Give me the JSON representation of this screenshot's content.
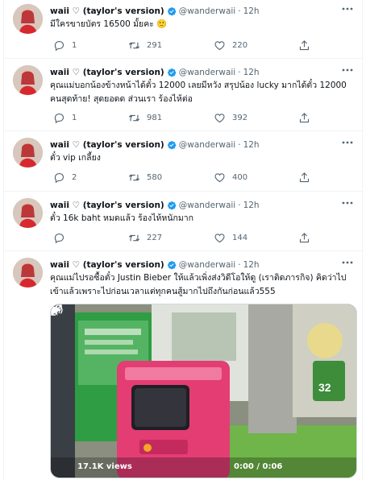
{
  "colors": {
    "accent": "#1d9bf0",
    "muted": "#536471",
    "text": "#0f1419",
    "border": "#eff3f4"
  },
  "tweets": [
    {
      "name": "waii ♡ (taylor's version)",
      "handle": "@wanderwaii",
      "dot": "·",
      "time": "12h",
      "text": "มีใครขายบัตร 16500 มั้ยคะ 🙂",
      "replies": "1",
      "retweets": "291",
      "likes": "220"
    },
    {
      "name": "waii ♡ (taylor's version)",
      "handle": "@wanderwaii",
      "dot": "·",
      "time": "12h",
      "text": "คุณแม่บอกน้องข้างหน้าได้ตั๋ว 12000 เลยมีหวัง สรุปน้อง lucky มากได้ตั๋ว 12000 คนสุดท้าย! สุดยอดด ส่วนเรา ร้องไห้ต่อ",
      "replies": "1",
      "retweets": "981",
      "likes": "392"
    },
    {
      "name": "waii ♡ (taylor's version)",
      "handle": "@wanderwaii",
      "dot": "·",
      "time": "12h",
      "text": "ตั๋ว vip เกลี้ยง",
      "replies": "2",
      "retweets": "580",
      "likes": "400"
    },
    {
      "name": "waii ♡ (taylor's version)",
      "handle": "@wanderwaii",
      "dot": "·",
      "time": "12h",
      "text": "ตั๋ว 16k baht หมดแล้ว ร้องไห้หนักมาก",
      "replies": "",
      "retweets": "227",
      "likes": "144"
    },
    {
      "name": "waii ♡ (taylor's version)",
      "handle": "@wanderwaii",
      "dot": "·",
      "time": "12h",
      "text": "คุณแม่ไปรอซื้อตั๋ว Justin Bieber ให้แล้วเพิ่งส่งวิดีโอให้ดู (เราติดภารกิจ) คิดว่าไปเข้าแล้วเพราะไปก่อนเวลาแต่ทุกคนสู้มากไปถึงกันก่อนแล้ว555",
      "video": {
        "views": "17.1K views",
        "time": "0:00 / 0:06",
        "poster_number": "32"
      }
    }
  ]
}
